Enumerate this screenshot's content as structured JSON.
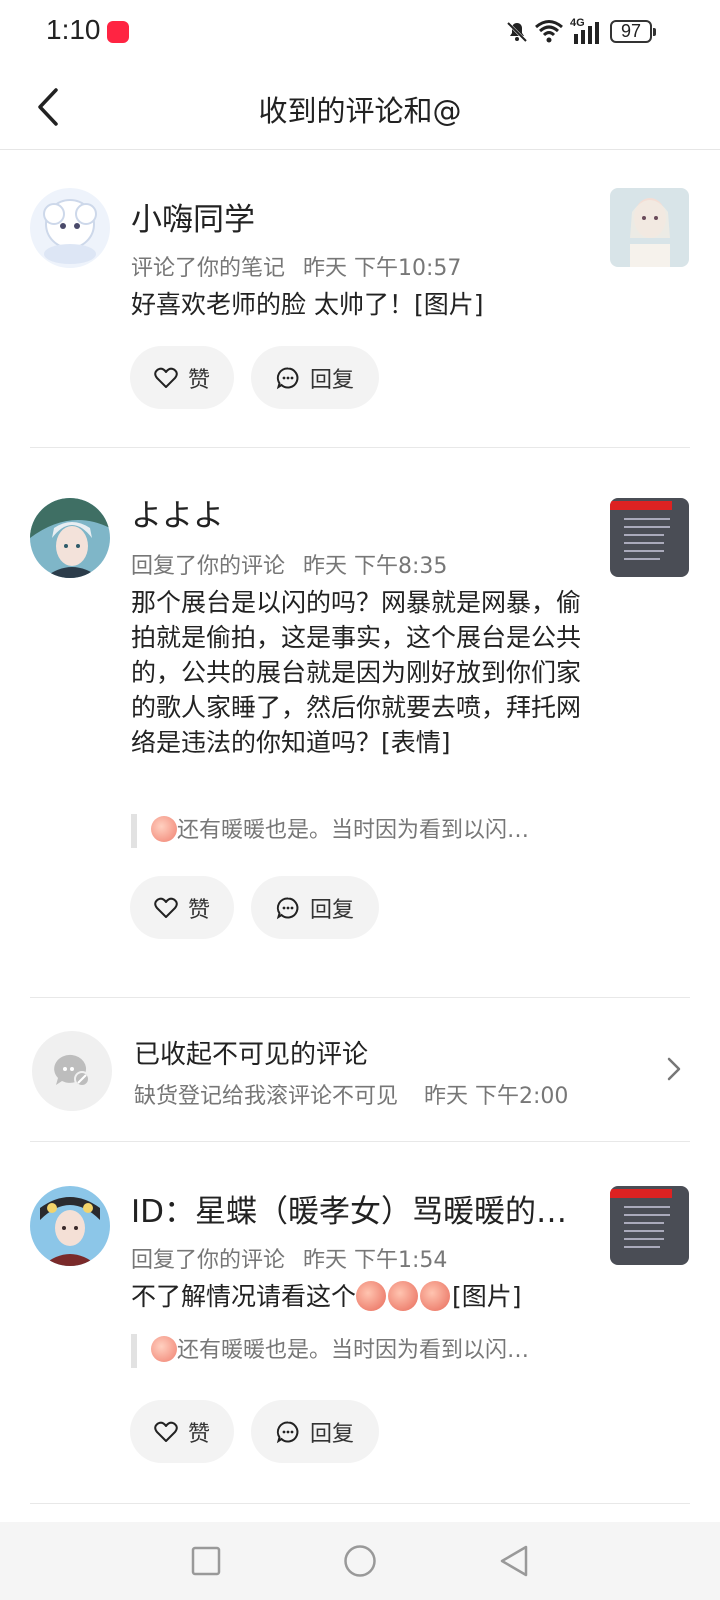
{
  "status_bar": {
    "time": "1:10",
    "network": "4G",
    "battery": "97"
  },
  "header": {
    "title": "收到的评论和@"
  },
  "items": [
    {
      "name": "小嗨同学",
      "action": "评论了你的笔记",
      "time": "昨天 下午10:57",
      "content": "好喜欢老师的脸 太帅了！[图片]",
      "like_label": "赞",
      "reply_label": "回复"
    },
    {
      "name": "よよよ",
      "action": "回复了你的评论",
      "time": "昨天 下午8:35",
      "content": "那个展台是以闪的吗？网暴就是网暴，偷拍就是偷拍，这是事实，这个展台是公共的，公共的展台就是因为刚好放到你们家的歌人家睡了，然后你就要去喷，拜托网络是违法的你知道吗？[表情]",
      "quote": "还有暖暖也是。当时因为看到以闪…",
      "like_label": "赞",
      "reply_label": "回复"
    },
    {
      "name": "ID：星蝶（暖孝女）骂暖暖的…",
      "action": "回复了你的评论",
      "time": "昨天 下午1:54",
      "content_text": "不了解情况请看这个",
      "content_suffix": "[图片]",
      "quote": "还有暖暖也是。当时因为看到以闪…",
      "like_label": "赞",
      "reply_label": "回复"
    }
  ],
  "collapsed": {
    "title": "已收起不可见的评论",
    "subtitle": "缺货登记给我滚评论不可见",
    "time": "昨天 下午2:00"
  },
  "colors": {
    "accent": "#ff2442",
    "button_bg": "#f3f3f3",
    "meta_text": "#777777"
  }
}
